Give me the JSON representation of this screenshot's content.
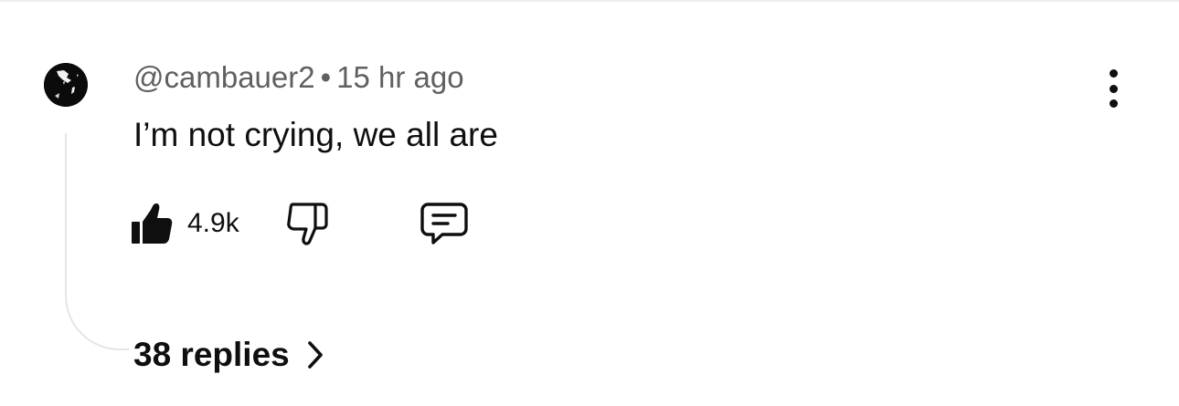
{
  "comment": {
    "author_handle": "@cambauer2",
    "separator": "•",
    "timestamp": "15 hr ago",
    "text": "I’m not crying, we all are",
    "like_count": "4.9k",
    "replies_label": "38 replies"
  },
  "colors": {
    "text_primary": "#0f0f0f",
    "text_secondary": "#606060",
    "thread_line": "#e5e5e5",
    "avatar_bg": "#0b0b0b"
  },
  "icons": {
    "avatar": "profile-avatar",
    "more": "vertical-ellipsis-icon",
    "like": "thumbs-up-filled-icon",
    "dislike": "thumbs-down-outline-icon",
    "reply": "comment-bubble-icon",
    "expand": "chevron-right-icon"
  }
}
